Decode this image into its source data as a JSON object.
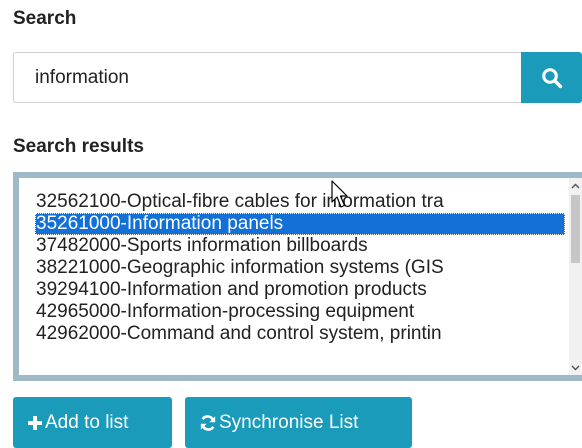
{
  "search": {
    "label": "Search",
    "value": "information",
    "button_icon": "search-icon"
  },
  "results": {
    "label": "Search results",
    "selected_index": 1,
    "items": [
      "32562100-Optical-fibre cables for information tra",
      "35261000-Information panels",
      "37482000-Sports information billboards",
      "38221000-Geographic information systems (GIS",
      "39294100-Information and promotion products",
      "42965000-Information-processing equipment",
      "42962000-Command and control system, printin"
    ]
  },
  "actions": {
    "add_label": "Add to list",
    "add_icon": "plus-icon",
    "sync_label": "Synchronise List",
    "sync_icon": "refresh-icon"
  },
  "colors": {
    "accent": "#1a9bb9",
    "selection": "#1270d6",
    "list_border": "#9fb9c6"
  }
}
